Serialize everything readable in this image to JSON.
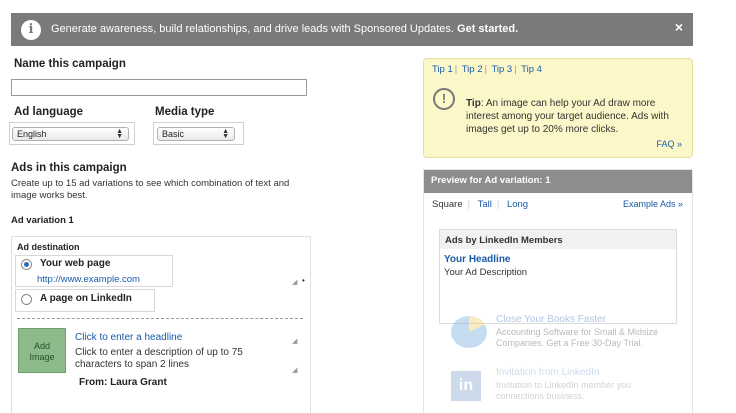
{
  "banner": {
    "text": "Generate awareness, build relationships, and drive leads with Sponsored Updates.",
    "cta": "Get started.",
    "close_glyph": "×",
    "info_glyph": "i"
  },
  "form": {
    "campaign_name_label": "Name this campaign",
    "campaign_name_value": "",
    "ad_language_label": "Ad language",
    "ad_language_value": "English",
    "media_type_label": "Media type",
    "media_type_value": "Basic"
  },
  "ads_section": {
    "title": "Ads in this campaign",
    "description_line1": "Create up to 15 ad variations to see which combination of text and",
    "description_line2": "image works best.",
    "variation_label": "Ad variation 1",
    "destination_label": "Ad destination",
    "option_web_label": "Your web page",
    "option_web_url": "http://www.example.com",
    "option_linkedin_label": "A page on LinkedIn",
    "add_image_line1": "Add",
    "add_image_line2": "Image",
    "headline_prompt": "Click to enter a headline",
    "description_prompt_line1": "Click to enter a description of up to 75",
    "description_prompt_line2": "characters to span 2 lines",
    "from_line": "From: Laura Grant"
  },
  "tips": {
    "tabs": [
      "Tip 1",
      "Tip 2",
      "Tip 3",
      "Tip 4"
    ],
    "tip_label": "Tip",
    "tip_text": ": An image can help your Ad draw more interest among your target audience. Ads with images get up to 20% more clicks.",
    "faq": "FAQ »",
    "icon_glyph": "!"
  },
  "preview": {
    "title": "Preview for Ad variation: 1",
    "tabs": [
      "Square",
      "Tall",
      "Long"
    ],
    "example_ads": "Example Ads »",
    "card_title": "Ads by LinkedIn Members",
    "headline": "Your Headline",
    "description": "Your Ad Description",
    "example1_title": "Close Your Books Faster",
    "example1_line1": "Accounting Software for Small & Midsize",
    "example1_line2": "Companies. Get a Free 30-Day Trial.",
    "example2_title": "Invitation from LinkedIn",
    "example2_line1": "Invitation to LinkedIn member you",
    "example2_line2": "connections business."
  },
  "colors": {
    "banner_bg": "#7a7a7a",
    "link": "#1a5aa8",
    "tip_bg": "#fcf7c9",
    "preview_header_bg": "#8d8d8d"
  }
}
